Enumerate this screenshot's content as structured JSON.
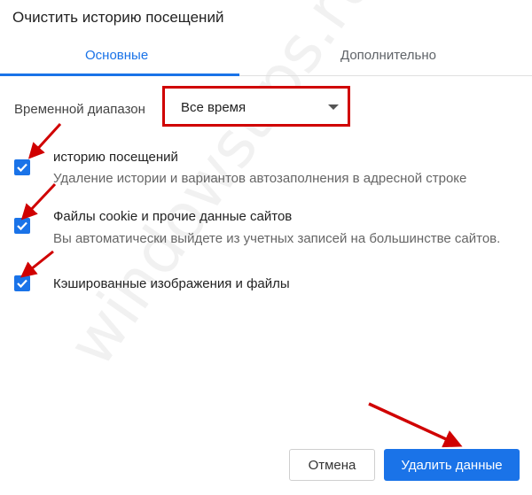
{
  "dialog": {
    "title": "Очистить историю посещений",
    "tabs": [
      {
        "label": "Основные",
        "active": true
      },
      {
        "label": "Дополнительно",
        "active": false
      }
    ],
    "time_range": {
      "label": "Временной диапазон",
      "selected": "Все время"
    },
    "options": [
      {
        "title": "историю посещений",
        "description": "Удаление истории и вариантов автозаполнения в адресной строке",
        "checked": true
      },
      {
        "title": "Файлы cookie и прочие данные сайтов",
        "description": "Вы автоматически выйдете из учетных записей на большинстве сайтов.",
        "checked": true
      },
      {
        "title": "Кэшированные изображения и файлы",
        "description": "",
        "checked": true
      }
    ],
    "buttons": {
      "cancel": "Отмена",
      "delete": "Удалить данные"
    }
  },
  "watermark": "windowstips.ru",
  "colors": {
    "accent": "#1a73e8",
    "annotation": "#d00000"
  }
}
